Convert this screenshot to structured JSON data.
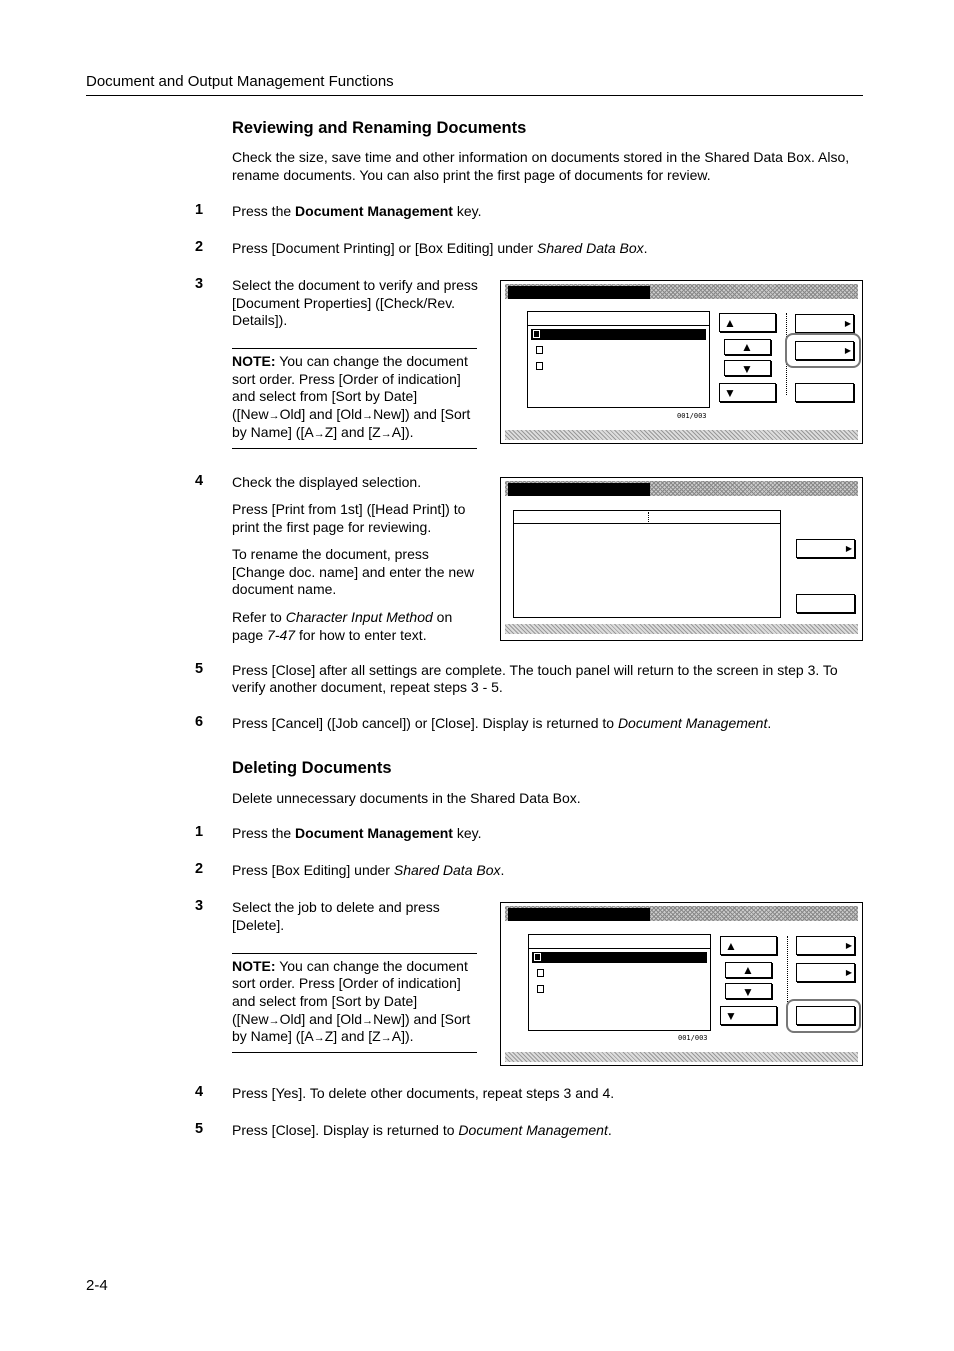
{
  "header": {
    "title": "Document and Output Management Functions"
  },
  "section1": {
    "heading": "Reviewing and Renaming Documents",
    "intro_l1": "Check the size, save time and other information on documents stored in the Shared Data Box. Also,",
    "intro_l2": "rename documents. You can also print the first page of documents for review.",
    "steps": [
      {
        "num": "1",
        "pre": "Press the ",
        "bold": "Document Management",
        "post": " key."
      },
      {
        "num": "2",
        "pre": "Press [Document Printing] or [Box Editing] under ",
        "italic": "Shared Data Box",
        "post": "."
      },
      {
        "num": "3",
        "l1": "Select the document to verify and press",
        "l2": "[Document Properties] ([Check/Rev.",
        "l3": "Details])."
      },
      {
        "num": "4",
        "l1": "Check the displayed selection."
      },
      {
        "num": "5",
        "l1": "Press [Close] after all settings are complete.  The touch panel will return to the screen in step 3. To",
        "l2": "verify another document, repeat steps 3 - 5."
      },
      {
        "num": "6",
        "pre": "Press [Cancel] ([Job cancel]) or [Close]. Display is returned to ",
        "italic": "Document Management",
        "post": "."
      }
    ],
    "note": {
      "label": "NOTE:",
      "l1": " You can change the document",
      "l2": "sort order. Press  [Order of indication]",
      "l3": "and select from [Sort by Date]",
      "l4a": "([New",
      "l4b": "Old] and [Old",
      "l4c": "New]) and [Sort",
      "l5a": "by Name] ([A",
      "l5b": "Z] and [Z",
      "l5c": "A])."
    },
    "step4_p2_l1": "Press [Print from 1st] ([Head Print]) to",
    "step4_p2_l2": "print the first page for reviewing.",
    "step4_p3_l1": "To rename the document, press",
    "step4_p3_l2": "[Change doc. name] and enter the new",
    "step4_p3_l3": "document name.",
    "step4_p4_pre": "Refer to ",
    "step4_p4_italic": "Character Input Method",
    "step4_p4_mid": " on",
    "step4_p4_l2a": "page ",
    "step4_p4_l2i": "7-47",
    "step4_p4_l2b": " for how to enter text."
  },
  "section2": {
    "heading": "Deleting Documents",
    "intro": "Delete unnecessary documents in the Shared Data Box.",
    "steps": [
      {
        "num": "1",
        "pre": "Press the ",
        "bold": "Document Management",
        "post": " key."
      },
      {
        "num": "2",
        "pre": "Press [Box Editing] under ",
        "italic": "Shared Data Box",
        "post": "."
      },
      {
        "num": "3",
        "l1": "Select the job to delete and press",
        "l2": "[Delete]."
      },
      {
        "num": "4",
        "l1": "Press [Yes]. To delete other documents, repeat steps 3 and 4."
      },
      {
        "num": "5",
        "pre": "Press [Close]. Display is returned to ",
        "italic": "Document Management",
        "post": "."
      }
    ]
  },
  "arrow_glyph": "→",
  "screens": {
    "counter": "001/003"
  },
  "footer": {
    "page": "2-4"
  }
}
